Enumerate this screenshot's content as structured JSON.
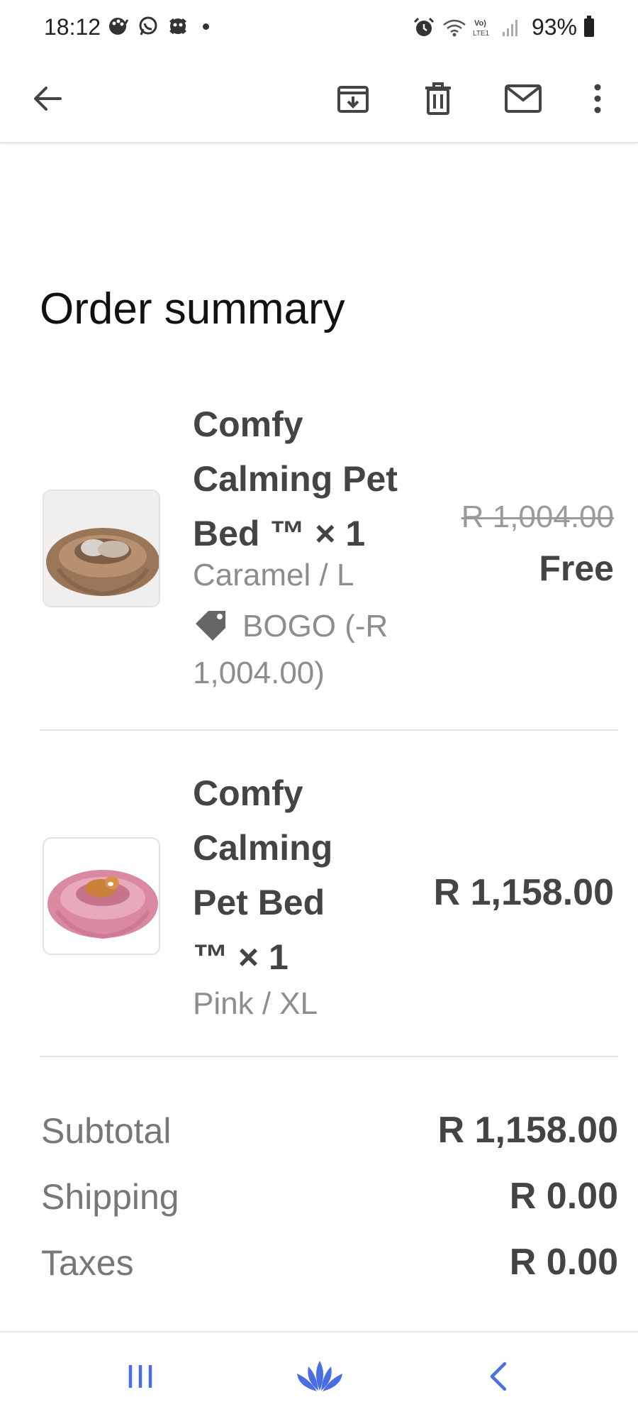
{
  "status_bar": {
    "time": "18:12",
    "battery": "93%",
    "left_icons": [
      "palette-icon",
      "whatsapp-icon",
      "app-icon",
      "dot-icon"
    ],
    "right_icons": [
      "alarm-icon",
      "wifi-icon",
      "volte-icon",
      "signal-icon",
      "battery-icon"
    ]
  },
  "toolbar": {
    "icons": [
      "back-arrow-icon",
      "archive-icon",
      "delete-icon",
      "mail-icon",
      "more-vert-icon"
    ]
  },
  "order": {
    "title": "Order summary",
    "items": [
      {
        "name": "Comfy Calming Pet Bed ™ × 1",
        "variant": "Caramel / L",
        "discount": "BOGO (-R 1,004.00)",
        "original_price": "R 1,004.00",
        "price": "Free",
        "image": "caramel-pet-bed-with-cat"
      },
      {
        "name": "Comfy Calming Pet Bed ™ × 1",
        "variant": "Pink / XL",
        "price": "R 1,158.00",
        "image": "pink-pet-bed-with-dog"
      }
    ],
    "totals": [
      {
        "label": "Subtotal",
        "value": "R 1,158.00"
      },
      {
        "label": "Shipping",
        "value": "R 0.00"
      },
      {
        "label": "Taxes",
        "value": "R 0.00"
      }
    ]
  },
  "nav_bar": {
    "icons": [
      "recents-icon",
      "home-lotus-icon",
      "back-icon"
    ],
    "accent": "#4a6ee0"
  },
  "colors": {
    "text_dark": "#444444",
    "text_muted": "#8d8d8d",
    "divider": "#e3e3e3"
  }
}
